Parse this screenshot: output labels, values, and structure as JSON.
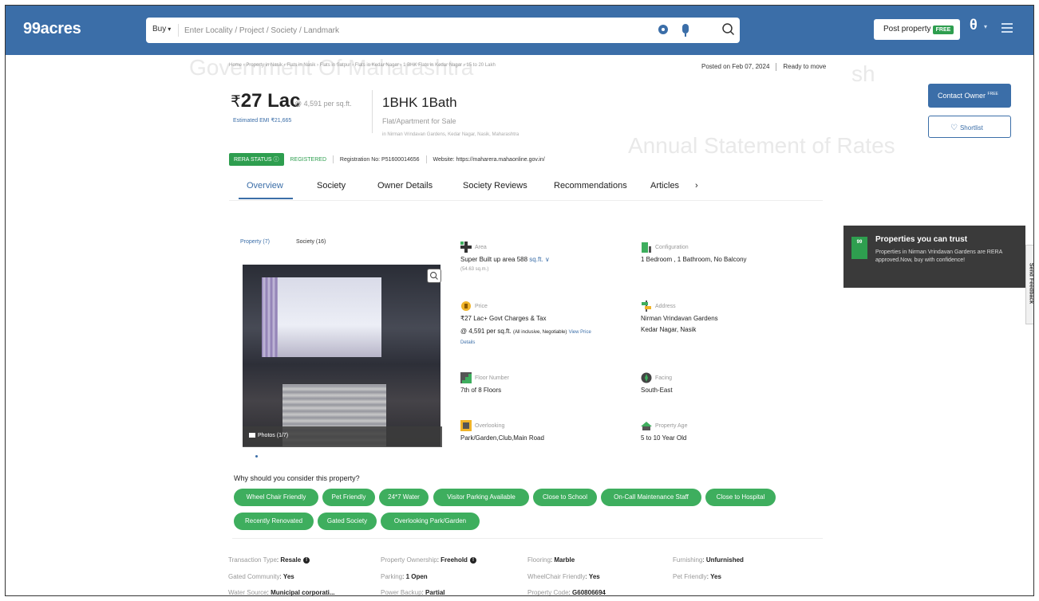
{
  "header": {
    "logo": "99acres",
    "buy_label": "Buy",
    "search_placeholder": "Enter Locality / Project / Society / Landmark",
    "post_property": "Post property",
    "free_badge": "FREE"
  },
  "watermark": {
    "line1": "Government Of Maharashtra",
    "line2": "Annual Statement of Rates",
    "line3": "sh"
  },
  "breadcrumb": "Home › Property in Nasik › Flats in Nasik › Flats in Satpur › Flats in Kedar Nagar › 1 BHK Flats in Kedar Nagar › 15 to 20 Lakh",
  "posted": {
    "date": "Posted on Feb 07, 2024",
    "status": "Ready to move"
  },
  "summary": {
    "currency": "₹",
    "price": "27 Lac",
    "per_sqft": "@ 4,591 per sq.ft.",
    "emi": "Estimated EMI ₹21,665",
    "config": "1BHK 1Bath",
    "sale_type": "Flat/Apartment for Sale",
    "address": "in Nirman Vrindavan Gardens, Kedar Nagar, Nasik, Maharashtra"
  },
  "rera": {
    "badge": "RERA STATUS",
    "status": "REGISTERED",
    "reg_no": "Registration No: P51600014656",
    "website": "Website: https://maharera.mahaonline.gov.in/"
  },
  "tabs": [
    "Overview",
    "Society",
    "Owner Details",
    "Society Reviews",
    "Recommendations",
    "Articles",
    "›"
  ],
  "actions": {
    "contact": "Contact Owner",
    "contact_sup": "FREE",
    "shortlist": "Shortlist"
  },
  "trust": {
    "icon_text": "99",
    "title": "Properties you can trust",
    "text": "Properties in Nirman Vrindavan Gardens are RERA approved.Now, buy with confidence!"
  },
  "feedback": "Send Feedback",
  "gallery": {
    "tab_property": "Property (7)",
    "tab_society": "Society (16)",
    "photo_count": "Photos (1/7)"
  },
  "details": {
    "area": {
      "label": "Area",
      "value": "Super Built up area 588",
      "unit": "sq.ft.",
      "sub": "(54.63 sq.m.)"
    },
    "configuration": {
      "label": "Configuration",
      "value": "1 Bedroom , 1 Bathroom, No Balcony"
    },
    "price": {
      "label": "Price",
      "value": "27 Lac+ Govt Charges & Tax",
      "sub": "@ 4,591 per sq.ft.",
      "sub2": "(All inclusive, Negotiable)",
      "link": "View Price",
      "link2": "Details"
    },
    "address": {
      "label": "Address",
      "value": "Nirman Vrindavan Gardens",
      "value2": "Kedar Nagar, Nasik"
    },
    "floor": {
      "label": "Floor Number",
      "value": "7th of 8 Floors"
    },
    "facing": {
      "label": "Facing",
      "value": "South-East"
    },
    "overlooking": {
      "label": "Overlooking",
      "value": "Park/Garden,Club,Main Road"
    },
    "age": {
      "label": "Property Age",
      "value": "5 to 10 Year Old"
    }
  },
  "why": {
    "title": "Why should you consider this property?",
    "chips": [
      "Wheel Chair Friendly",
      "Pet Friendly",
      "24*7 Water",
      "Visitor Parking Available",
      "Close to School",
      "On-Call Maintenance Staff",
      "Close to Hospital",
      "Recently Renovated",
      "Gated Society",
      "Overlooking Park/Garden"
    ]
  },
  "attributes": [
    {
      "k": "Transaction Type",
      "v": "Resale",
      "info": true
    },
    {
      "k": "Property Ownership",
      "v": "Freehold",
      "info": true
    },
    {
      "k": "Flooring",
      "v": "Marble"
    },
    {
      "k": "Furnishing",
      "v": "Unfurnished"
    },
    {
      "k": "Gated Community",
      "v": "Yes"
    },
    {
      "k": "Parking",
      "v": "1 Open"
    },
    {
      "k": "WheelChair Friendly",
      "v": "Yes"
    },
    {
      "k": "Pet Friendly",
      "v": "Yes"
    },
    {
      "k": "Water Source",
      "v": "Municipal corporati..."
    },
    {
      "k": "Power Backup",
      "v": "Partial"
    },
    {
      "k": "Property Code",
      "v": "G60806694"
    }
  ],
  "colors": {
    "brand": "#3b6ea8",
    "green": "#2e9e4f"
  }
}
